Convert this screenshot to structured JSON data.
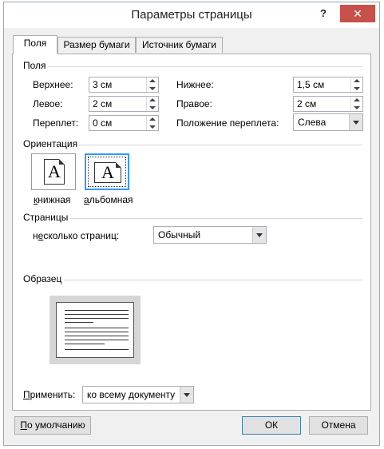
{
  "window": {
    "title": "Параметры страницы",
    "help_label": "?",
    "close_label": "✕"
  },
  "tabs": [
    {
      "label": "Поля",
      "active": true
    },
    {
      "label": "Размер бумаги",
      "active": false
    },
    {
      "label": "Источник бумаги",
      "active": false
    }
  ],
  "margins": {
    "group_title": "Поля",
    "top": {
      "label": "Верхнее:",
      "value": "3 см"
    },
    "bottom": {
      "label": "Нижнее:",
      "value": "1,5 см"
    },
    "left": {
      "label": "Левое:",
      "value": "2 см"
    },
    "right": {
      "label": "Правое:",
      "value": "2 см"
    },
    "gutter": {
      "label": "Переплет:",
      "value": "0 см"
    },
    "gutter_position": {
      "label": "Положение переплета:",
      "value": "Слева"
    }
  },
  "orientation": {
    "group_title": "Ориентация",
    "portrait_label": "книжная",
    "landscape_label": "альбомная",
    "letter": "A",
    "selected": "landscape"
  },
  "pages": {
    "group_title": "Страницы",
    "multiple_label": "несколько страниц:",
    "multiple_value": "Обычный"
  },
  "preview": {
    "group_title": "Образец"
  },
  "apply": {
    "label": "Применить:",
    "value": "ко всему документу"
  },
  "buttons": {
    "default_label": "По умолчанию",
    "ok_label": "ОК",
    "cancel_label": "Отмена"
  },
  "colors": {
    "close_button": "#c7504a",
    "selection_border": "#3399ff",
    "default_button_border": "#3c7fb1"
  }
}
